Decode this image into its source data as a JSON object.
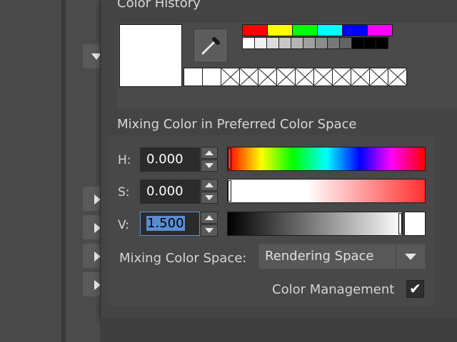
{
  "color_history": {
    "title": "Color History",
    "current_color": "#ffffff",
    "eyedropper_icon": "eyedropper-icon",
    "palette_row1": [
      "#ff0000",
      "#ffff00",
      "#00ff00",
      "#00ffff",
      "#0000ff",
      "#ff00ff"
    ],
    "palette_row2": [
      "#ffffff",
      "#f0f0f0",
      "#dcdcdc",
      "#c8c8c8",
      "#b4b4b4",
      "#a0a0a0",
      "#8c8c8c",
      "#787878",
      "#646464",
      "#000000",
      "#000000",
      "#000000"
    ],
    "history_slots": [
      "filled",
      "filled",
      "empty",
      "empty",
      "empty",
      "empty",
      "empty",
      "empty",
      "empty",
      "empty",
      "empty",
      "empty"
    ]
  },
  "mixing": {
    "title": "Mixing Color in Preferred Color Space",
    "h": {
      "label": "H:",
      "value": "0.000",
      "fraction": 0.0
    },
    "s": {
      "label": "S:",
      "value": "0.000",
      "fraction": 0.0
    },
    "v": {
      "label": "V:",
      "value": "1.500",
      "fraction": 1.0
    },
    "color_space_label": "Mixing Color Space:",
    "color_space_value": "Rendering Space",
    "color_management_label": "Color Management",
    "color_management_checked": true
  }
}
